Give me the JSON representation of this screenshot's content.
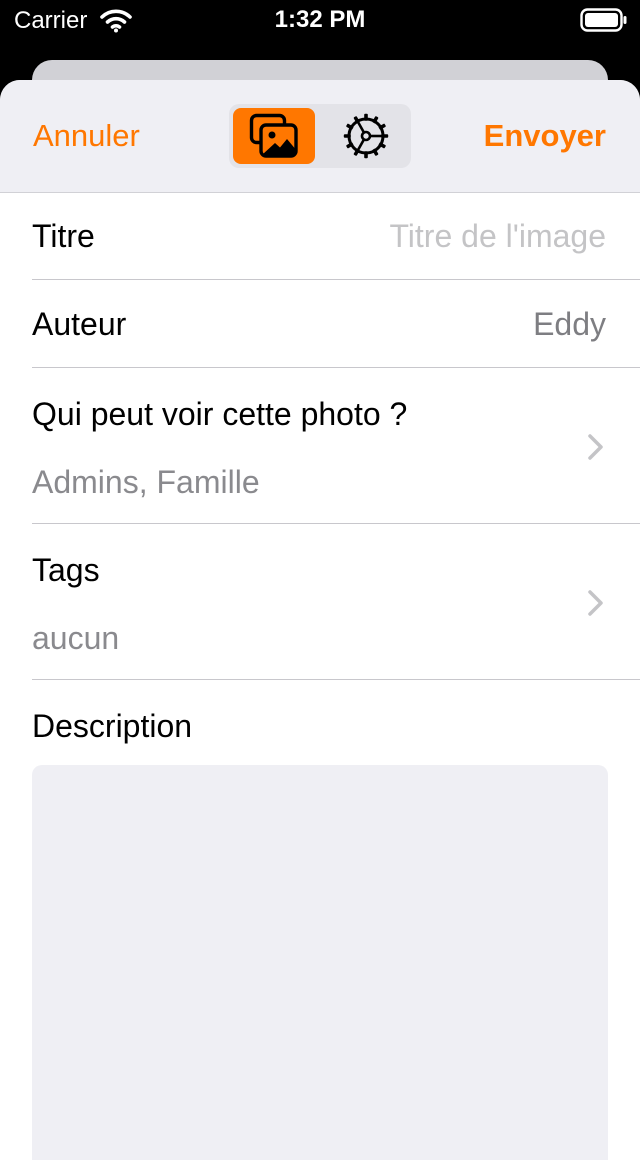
{
  "status_bar": {
    "carrier": "Carrier",
    "time": "1:32 PM",
    "icons": [
      "wifi-icon",
      "battery-icon"
    ]
  },
  "nav": {
    "cancel_label": "Annuler",
    "send_label": "Envoyer",
    "segments": [
      {
        "icon": "photos-icon",
        "selected": true
      },
      {
        "icon": "gear-icon",
        "selected": false
      }
    ]
  },
  "form": {
    "title_label": "Titre",
    "title_placeholder": "Titre de l'image",
    "author_label": "Auteur",
    "author_value": "Eddy",
    "privacy_label": "Qui peut voir cette photo ?",
    "privacy_value": "Admins, Famille",
    "tags_label": "Tags",
    "tags_value": "aucun",
    "description_label": "Description"
  },
  "colors": {
    "accent": "#ff7700",
    "nav_background": "#efeff4",
    "placeholder": "#c4c4c6",
    "secondary_text": "#8a8a8e"
  }
}
